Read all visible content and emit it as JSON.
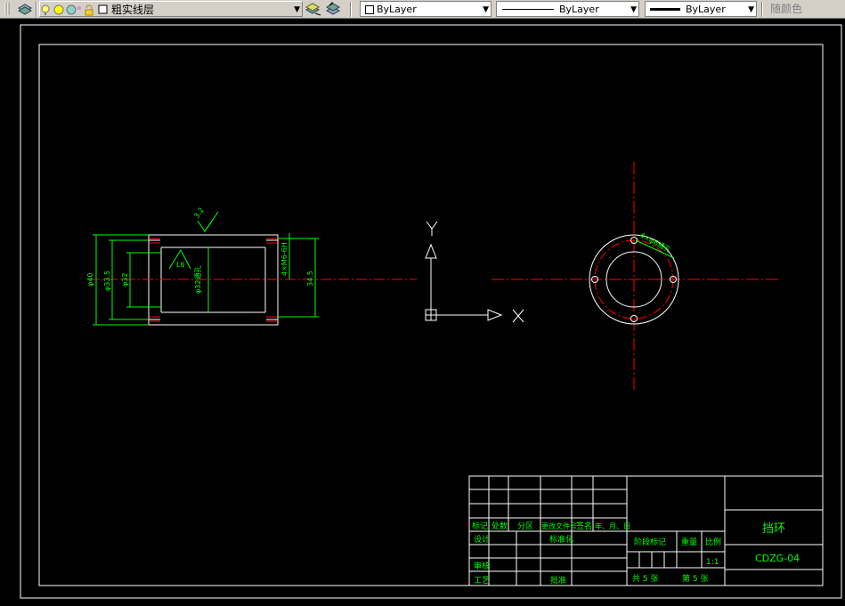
{
  "toolbar": {
    "layer_name": "粗实线层",
    "color": "ByLayer",
    "linetype": "ByLayer",
    "lineweight": "ByLayer",
    "plotstyle": "随颜色"
  },
  "drawing": {
    "dim_phi40": "φ40",
    "dim_phi33_5": "φ33.5",
    "dim_phi32": "φ32",
    "dim_inner": "φ32通孔",
    "dim_length": "34.5",
    "dim_holes": "4×M6-6H",
    "dim_slope": "L6",
    "roughness": "3.2",
    "hole_note": "4×φ6通孔",
    "ucs_x": "X",
    "ucs_y": "Y"
  },
  "title_block": {
    "header_labels": [
      "标记",
      "处数",
      "分区",
      "更改文件号",
      "签名",
      "年、月、日"
    ],
    "design": "设计",
    "standard": "标准化",
    "review": "审核",
    "process": "工艺",
    "approve": "批准",
    "stage_mark": "阶段标记",
    "weight": "重量",
    "scale": "比例",
    "scale_value": "1:1",
    "part_name": "挡环",
    "drawing_no": "CDZG-04",
    "sheets_total": "共  5  张",
    "sheet_no": "第  5  张"
  },
  "colors": {
    "toolbar_bg": "#d4d0c8",
    "border": "#ffffff",
    "dimension": "#00ff00",
    "centerline": "#ff0000"
  }
}
